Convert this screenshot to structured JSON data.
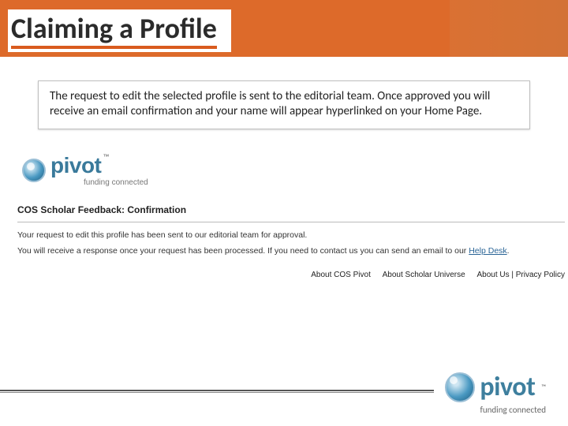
{
  "slide": {
    "title": "Claiming a Profile",
    "explain": "The request to edit the selected profile is sent to the editorial team. Once approved you will receive an email confirmation and your name will appear hyperlinked on your Home Page."
  },
  "shot": {
    "brand": "pivot",
    "tagline": "funding connected",
    "feedback_heading": "COS Scholar Feedback: Confirmation",
    "line1": "Your request to edit this profile has been sent to our editorial team for approval.",
    "line2_prefix": "You will receive a response once your request has been processed. If you need to contact us you can send an email to our ",
    "line2_link": "Help Desk",
    "line2_suffix": ".",
    "footer": {
      "a": "About COS Pivot",
      "b": "About Scholar Universe",
      "c": "About Us | Privacy Policy"
    }
  },
  "corner": {
    "brand": "pivot",
    "tagline": "funding connected"
  }
}
